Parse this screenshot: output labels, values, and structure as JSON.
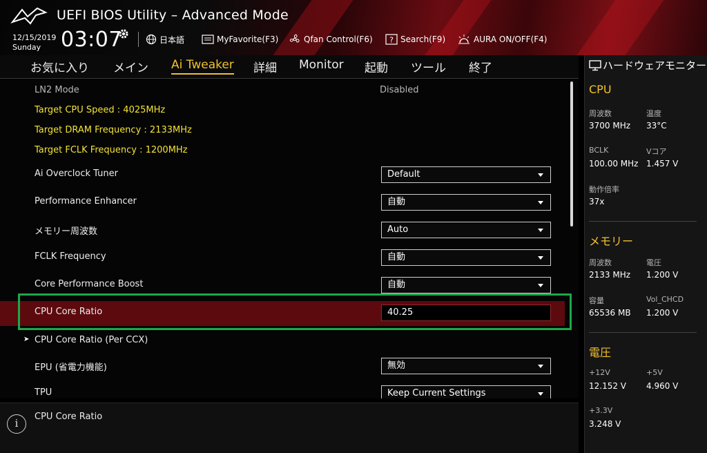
{
  "header": {
    "title": "UEFI BIOS Utility – Advanced Mode",
    "date": "12/15/2019",
    "weekday": "Sunday",
    "time": "03:07",
    "buttons": {
      "language": "日本語",
      "myfavorite": "MyFavorite(F3)",
      "qfan": "Qfan Control(F6)",
      "search": "Search(F9)",
      "aura": "AURA ON/OFF(F4)"
    }
  },
  "tabs": [
    "お気に入り",
    "メイン",
    "Ai Tweaker",
    "詳細",
    "Monitor",
    "起動",
    "ツール",
    "終了"
  ],
  "active_tab": "Ai Tweaker",
  "settings": {
    "ln2_label": "LN2 Mode",
    "ln2_value": "Disabled",
    "target_cpu": "Target CPU Speed : 4025MHz",
    "target_dram": "Target DRAM Frequency : 2133MHz",
    "target_fclk": "Target FCLK Frequency : 1200MHz",
    "items": [
      {
        "label": "Ai Overclock Tuner",
        "value": "Default"
      },
      {
        "label": "Performance Enhancer",
        "value": "自動"
      },
      {
        "label": "メモリー周波数",
        "value": "Auto"
      },
      {
        "label": "FCLK Frequency",
        "value": "自動"
      },
      {
        "label": "Core Performance Boost",
        "value": "自動"
      }
    ],
    "cpu_core_ratio_label": "CPU Core Ratio",
    "cpu_core_ratio_value": "40.25",
    "per_ccx_label": "CPU Core Ratio (Per CCX)",
    "epu_label": "EPU (省電力機能)",
    "epu_value": "無効",
    "tpu_label": "TPU",
    "tpu_value": "Keep Current Settings"
  },
  "help": {
    "text": "CPU Core Ratio"
  },
  "hardware_monitor": {
    "title": "ハードウェアモニター",
    "cpu": {
      "heading": "CPU",
      "freq_label": "周波数",
      "freq_value": "3700 MHz",
      "temp_label": "温度",
      "temp_value": "33°C",
      "bclk_label": "BCLK",
      "bclk_value": "100.00 MHz",
      "vcore_label": "Vコア",
      "vcore_value": "1.457 V",
      "ratio_label": "動作倍率",
      "ratio_value": "37x"
    },
    "memory": {
      "heading": "メモリー",
      "freq_label": "周波数",
      "freq_value": "2133 MHz",
      "volt_label": "電圧",
      "volt_value": "1.200 V",
      "cap_label": "容量",
      "cap_value": "65536 MB",
      "vchcd_label": "Vol_CHCD",
      "vchcd_value": "1.200 V"
    },
    "voltage": {
      "heading": "電圧",
      "v12_label": "+12V",
      "v12_value": "12.152 V",
      "v5_label": "+5V",
      "v5_value": "4.960 V",
      "v33_label": "+3.3V",
      "v33_value": "3.248 V"
    }
  },
  "colors": {
    "accent": "#f2c12e",
    "highlight_row": "#5c0a0e",
    "selection_frame": "#1ea84a",
    "info_text": "#f3e338"
  },
  "icons": [
    "rog-logo-icon",
    "gear-icon",
    "globe-icon",
    "myfavorite-icon",
    "fan-icon",
    "search-icon",
    "aura-icon",
    "monitor-icon",
    "info-icon",
    "chevron-right-icon",
    "dropdown-caret-icon"
  ]
}
